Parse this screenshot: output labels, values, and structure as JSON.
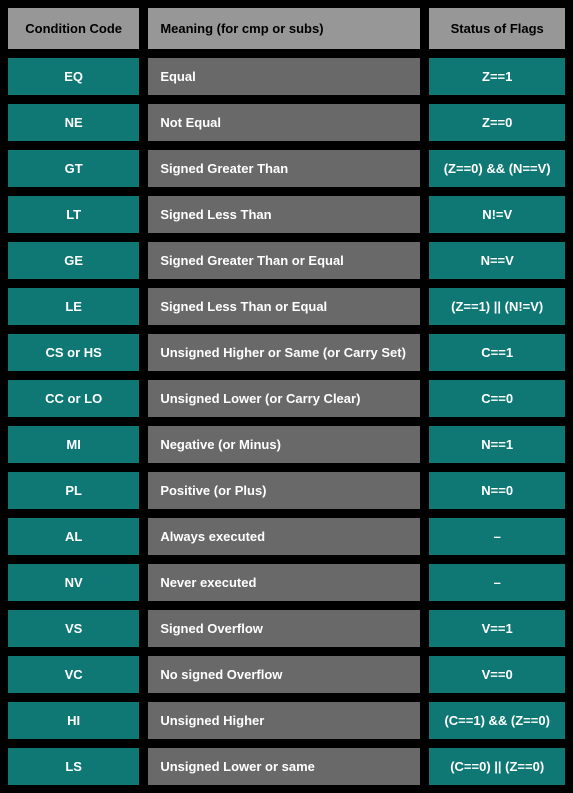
{
  "headers": {
    "code": "Condition Code",
    "meaning": "Meaning (for cmp or subs)",
    "flags": "Status of Flags"
  },
  "rows": [
    {
      "code": "EQ",
      "meaning": "Equal",
      "flags": "Z==1"
    },
    {
      "code": "NE",
      "meaning": "Not Equal",
      "flags": "Z==0"
    },
    {
      "code": "GT",
      "meaning": "Signed Greater Than",
      "flags": "(Z==0) && (N==V)"
    },
    {
      "code": "LT",
      "meaning": "Signed Less Than",
      "flags": "N!=V"
    },
    {
      "code": "GE",
      "meaning": "Signed Greater Than or Equal",
      "flags": "N==V"
    },
    {
      "code": "LE",
      "meaning": "Signed Less Than or Equal",
      "flags": "(Z==1) || (N!=V)"
    },
    {
      "code": "CS or HS",
      "meaning": "Unsigned Higher or Same (or Carry Set)",
      "flags": "C==1"
    },
    {
      "code": "CC or LO",
      "meaning": "Unsigned Lower (or Carry Clear)",
      "flags": "C==0"
    },
    {
      "code": "MI",
      "meaning": "Negative (or Minus)",
      "flags": "N==1"
    },
    {
      "code": "PL",
      "meaning": "Positive (or Plus)",
      "flags": "N==0"
    },
    {
      "code": "AL",
      "meaning": "Always executed",
      "flags": "–"
    },
    {
      "code": "NV",
      "meaning": "Never executed",
      "flags": "–"
    },
    {
      "code": "VS",
      "meaning": "Signed Overflow",
      "flags": "V==1"
    },
    {
      "code": "VC",
      "meaning": "No signed Overflow",
      "flags": "V==0"
    },
    {
      "code": "HI",
      "meaning": "Unsigned Higher",
      "flags": "(C==1) && (Z==0)"
    },
    {
      "code": "LS",
      "meaning": "Unsigned Lower or same",
      "flags": "(C==0) || (Z==0)"
    }
  ]
}
